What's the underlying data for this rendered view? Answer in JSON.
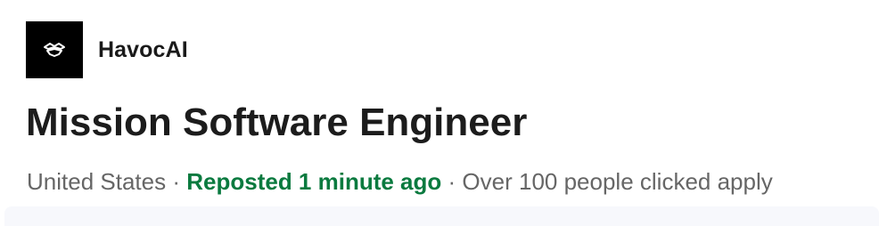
{
  "company": {
    "name": "HavocAI",
    "logo_icon": "havocai-logo-icon",
    "logo_bg": "#000000"
  },
  "job": {
    "title": "Mission Software Engineer"
  },
  "meta": {
    "location": "United States",
    "separator": "·",
    "reposted": "Reposted 1 minute ago",
    "applicants": "Over 100 people clicked apply",
    "reposted_color": "#0a7a3f"
  }
}
